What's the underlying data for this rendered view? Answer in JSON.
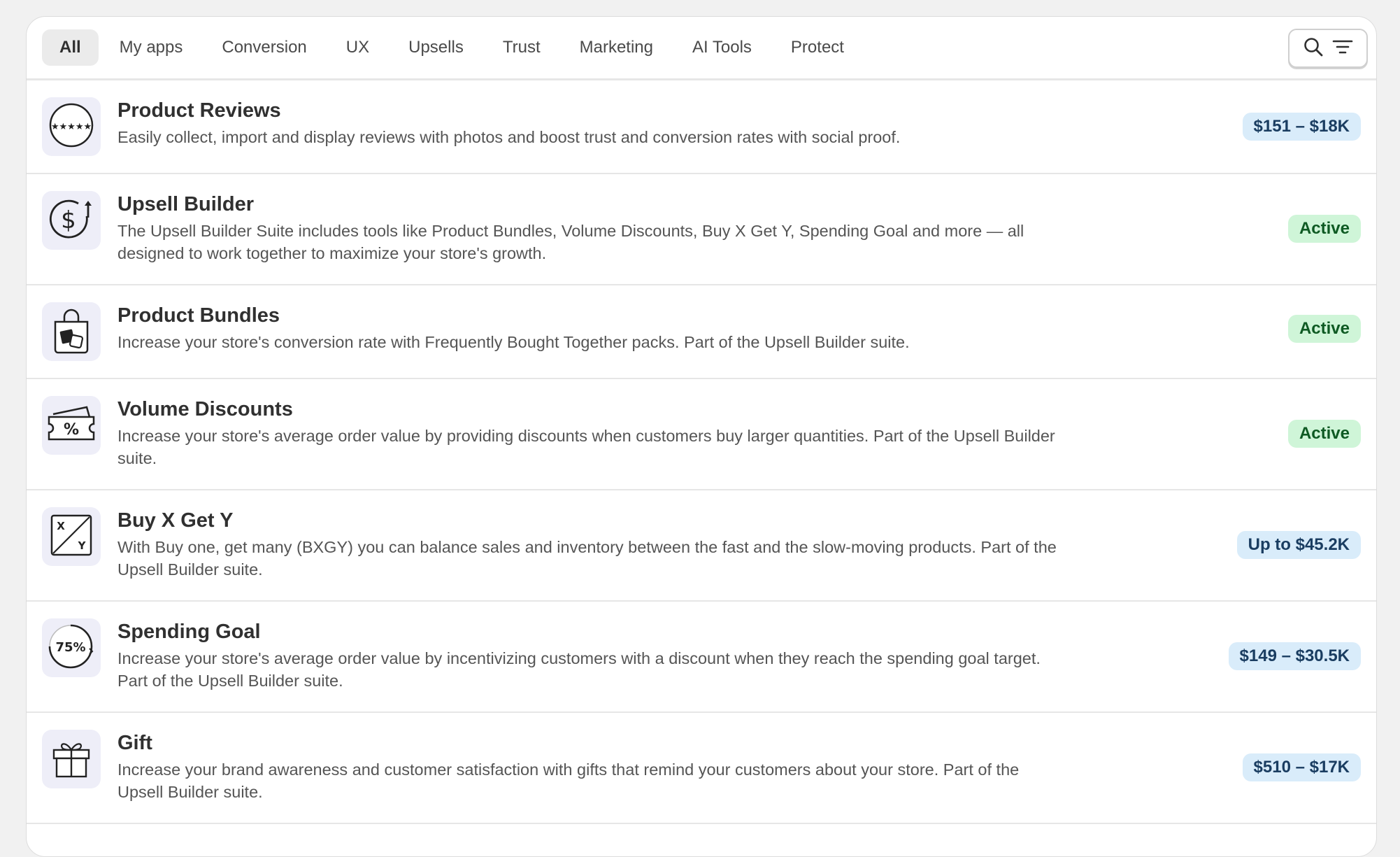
{
  "tabs": [
    {
      "label": "All",
      "active": true
    },
    {
      "label": "My apps"
    },
    {
      "label": "Conversion"
    },
    {
      "label": "UX"
    },
    {
      "label": "Upsells"
    },
    {
      "label": "Trust"
    },
    {
      "label": "Marketing"
    },
    {
      "label": "AI Tools"
    },
    {
      "label": "Protect"
    }
  ],
  "toolbar": {
    "search_icon": "search-icon",
    "filter_icon": "filter-icon"
  },
  "apps": [
    {
      "title": "Product Reviews",
      "description": "Easily collect, import and display reviews with photos and boost trust and conversion rates with social proof.",
      "badge": "$151 – $18K",
      "badge_type": "price",
      "icon": "rating-stars-icon"
    },
    {
      "title": "Upsell Builder",
      "description": "The Upsell Builder Suite includes tools like Product Bundles, Volume Discounts, Buy X Get Y, Spending Goal and more — all designed to work together to maximize your store's growth.",
      "badge": "Active",
      "badge_type": "active",
      "icon": "dollar-growth-icon"
    },
    {
      "title": "Product Bundles",
      "description": "Increase your store's conversion rate with Frequently Bought Together packs. Part of the Upsell Builder suite.",
      "badge": "Active",
      "badge_type": "active",
      "icon": "shopping-bag-icon"
    },
    {
      "title": "Volume Discounts",
      "description": "Increase your store's average order value by providing discounts when customers buy larger quantities. Part of the Upsell Builder suite.",
      "badge": "Active",
      "badge_type": "active",
      "icon": "discount-ticket-icon"
    },
    {
      "title": "Buy X Get Y",
      "description": "With Buy one, get many (BXGY) you can balance sales and inventory between the fast and the slow-moving products. Part of the Upsell Builder suite.",
      "badge": "Up to $45.2K",
      "badge_type": "price",
      "icon": "buy-x-get-y-icon"
    },
    {
      "title": "Spending Goal",
      "description": "Increase your store's average order value by incentivizing customers with a discount when they reach the spending goal target. Part of the Upsell Builder suite.",
      "badge": "$149 – $30.5K",
      "badge_type": "price",
      "icon": "progress-75-icon",
      "icon_text": "75%"
    },
    {
      "title": "Gift",
      "description": "Increase your brand awareness and customer satisfaction with gifts that remind your customers about your store. Part of the Upsell Builder suite.",
      "badge": "$510 – $17K",
      "badge_type": "price",
      "icon": "gift-icon"
    }
  ],
  "colors": {
    "price_badge_bg": "#d9ecfa",
    "active_badge_bg": "#cff5d8",
    "icon_bg": "#eeeef8"
  }
}
